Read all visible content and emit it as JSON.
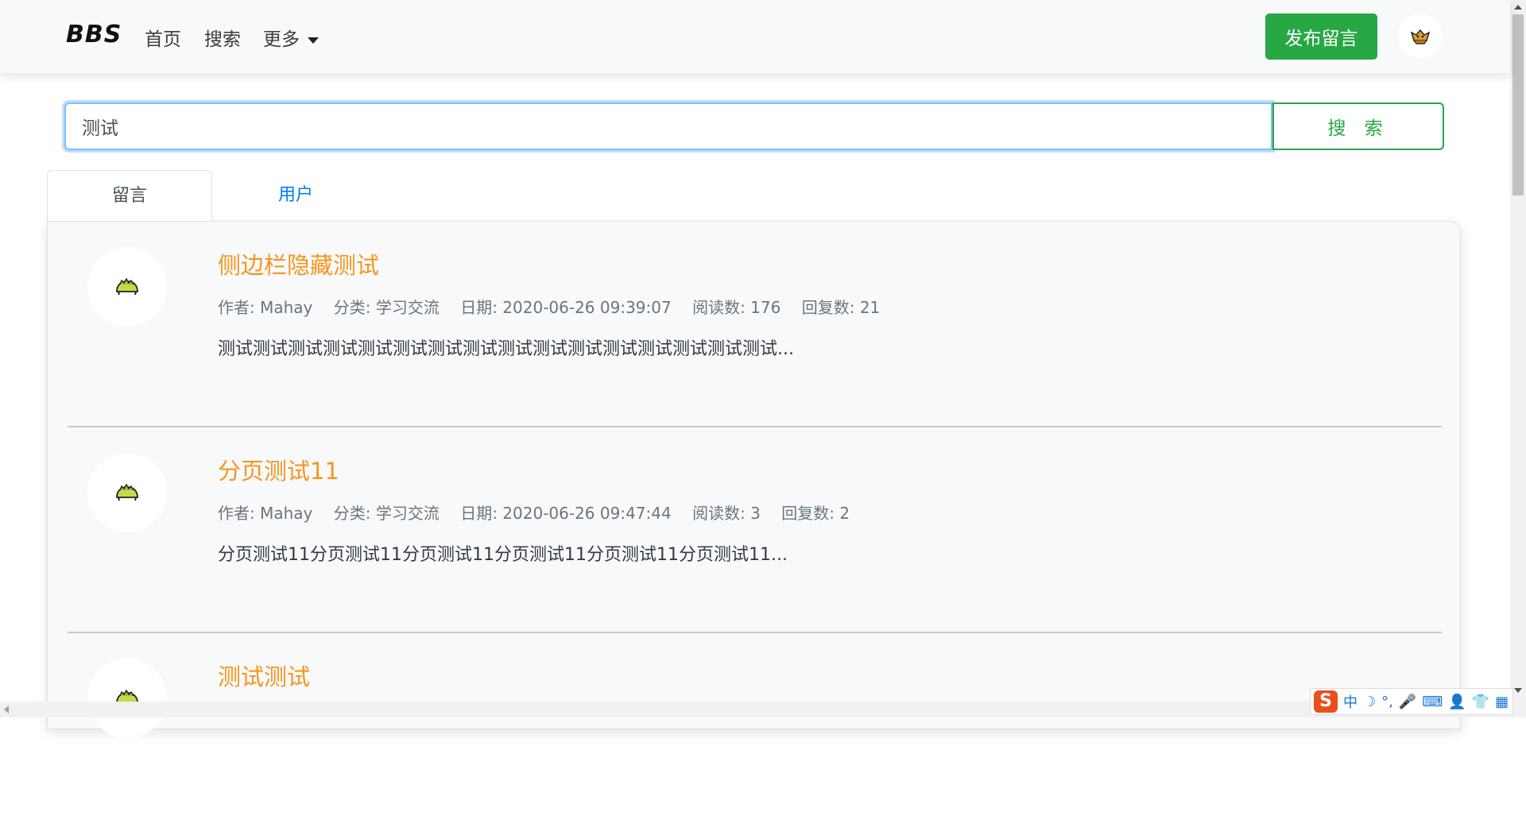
{
  "navbar": {
    "brand": "BBS",
    "links": [
      "首页",
      "搜索",
      "更多"
    ],
    "publish_label": "发布留言"
  },
  "search": {
    "value": "测试",
    "button_label": "搜 索"
  },
  "tabs": [
    {
      "label": "留言",
      "active": true
    },
    {
      "label": "用户",
      "active": false
    }
  ],
  "posts": [
    {
      "title": "侧边栏隐藏测试",
      "author": "作者: Mahay",
      "category": "分类: 学习交流",
      "date": "日期: 2020-06-26 09:39:07",
      "reads": "阅读数: 176",
      "replies": "回复数: 21",
      "excerpt": "测试测试测试测试测试测试测试测试测试测试测试测试测试测试测试测试..."
    },
    {
      "title": "分页测试11",
      "author": "作者: Mahay",
      "category": "分类: 学习交流",
      "date": "日期: 2020-06-26 09:47:44",
      "reads": "阅读数: 3",
      "replies": "回复数: 2",
      "excerpt": "分页测试11分页测试11分页测试11分页测试11分页测试11分页测试11..."
    },
    {
      "title": "测试测试"
    }
  ],
  "ime": {
    "logo": "S",
    "mode": "中",
    "items": [
      "☽",
      "°,",
      "🎤",
      "⌨",
      "👤",
      "👕",
      "▦"
    ]
  },
  "colors": {
    "accent_green": "#28a745",
    "title_orange": "#f7951e",
    "link_blue": "#007bff"
  }
}
